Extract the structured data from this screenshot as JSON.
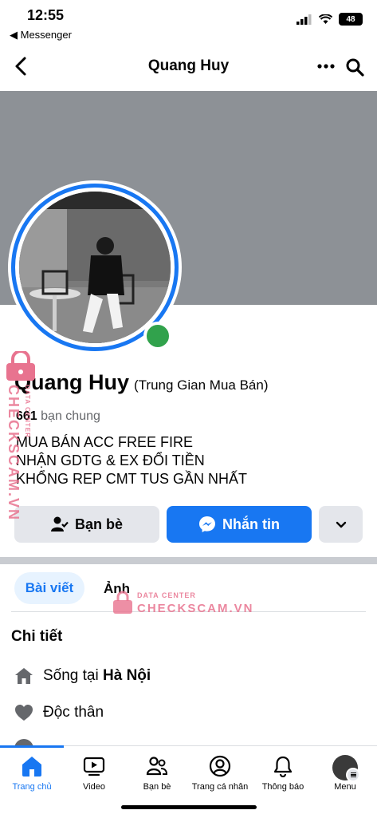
{
  "status": {
    "time": "12:55",
    "back_app": "◀ Messenger",
    "battery": "48"
  },
  "nav": {
    "title": "Quang Huy"
  },
  "profile": {
    "name": "Quang Huy",
    "subtitle": "(Trung Gian Mua Bán)",
    "mutual_count": "661",
    "mutual_label": "bạn chung",
    "bio": [
      "MUA BÁN ACC FREE FIRE",
      "NHẬN GDTG & EX ĐỔI TIỀN",
      "KHỔNG REP CMT TUS GẦN NHẤT"
    ]
  },
  "actions": {
    "friends": "Bạn bè",
    "message": "Nhắn tin"
  },
  "tabs": {
    "posts": "Bài viết",
    "photos": "Ảnh"
  },
  "details": {
    "title": "Chi tiết",
    "lives_prefix": "Sống tại ",
    "lives_city": "Hà Nội",
    "relationship": "Độc thân"
  },
  "watermark": {
    "vertical": "CHECKSCAM.VN",
    "vertical_small": "DATA CENTER",
    "center_small": "DATA CENTER",
    "center": "CHECKSCAM.VN"
  },
  "bottom_nav": {
    "home": "Trang chủ",
    "video": "Video",
    "friends": "Bạn bè",
    "profile": "Trang cá nhân",
    "notifications": "Thông báo",
    "menu": "Menu"
  },
  "colors": {
    "accent": "#1877f2",
    "online": "#31a24c",
    "cover": "#8d9196"
  }
}
